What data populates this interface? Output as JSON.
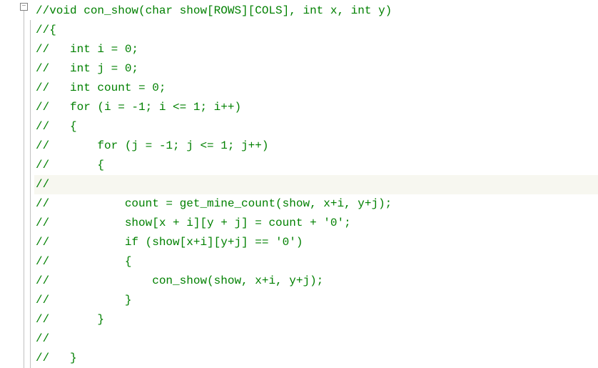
{
  "fold_marker": "−",
  "code": {
    "lines": [
      {
        "tokens": [
          {
            "t": "//void con_show(char show[ROWS][COLS], int x, int y)",
            "c": "comment"
          }
        ],
        "hl": false
      },
      {
        "tokens": [
          {
            "t": "//{",
            "c": "comment"
          }
        ],
        "hl": false
      },
      {
        "tokens": [
          {
            "t": "//   int i = 0;",
            "c": "comment"
          }
        ],
        "hl": false
      },
      {
        "tokens": [
          {
            "t": "//   int j = 0;",
            "c": "comment"
          }
        ],
        "hl": false
      },
      {
        "tokens": [
          {
            "t": "//   int count = 0;",
            "c": "comment"
          }
        ],
        "hl": false
      },
      {
        "tokens": [
          {
            "t": "//   for (i = -1; i <= 1; i++)",
            "c": "comment"
          }
        ],
        "hl": false
      },
      {
        "tokens": [
          {
            "t": "//   {",
            "c": "comment"
          }
        ],
        "hl": false
      },
      {
        "tokens": [
          {
            "t": "//       for (j = -1; j <= 1; j++)",
            "c": "comment"
          }
        ],
        "hl": false
      },
      {
        "tokens": [
          {
            "t": "//       {",
            "c": "comment"
          }
        ],
        "hl": false
      },
      {
        "tokens": [
          {
            "t": "//",
            "c": "comment"
          }
        ],
        "hl": true
      },
      {
        "tokens": [
          {
            "t": "//           count = get_mine_count(show, x+i, y+j);",
            "c": "comment"
          }
        ],
        "hl": false
      },
      {
        "tokens": [
          {
            "t": "//           show[x + i][y + j] = count + '0';",
            "c": "comment"
          }
        ],
        "hl": false
      },
      {
        "tokens": [
          {
            "t": "//           if (show[x+i][y+j] == '0')",
            "c": "comment"
          }
        ],
        "hl": false
      },
      {
        "tokens": [
          {
            "t": "//           {",
            "c": "comment"
          }
        ],
        "hl": false
      },
      {
        "tokens": [
          {
            "t": "//               con_show(show, x+i, y+j);",
            "c": "comment"
          }
        ],
        "hl": false
      },
      {
        "tokens": [
          {
            "t": "//           }",
            "c": "comment"
          }
        ],
        "hl": false
      },
      {
        "tokens": [
          {
            "t": "//       }",
            "c": "comment"
          }
        ],
        "hl": false
      },
      {
        "tokens": [
          {
            "t": "//",
            "c": "comment"
          }
        ],
        "hl": false
      },
      {
        "tokens": [
          {
            "t": "//   }",
            "c": "comment"
          }
        ],
        "hl": false
      }
    ]
  }
}
